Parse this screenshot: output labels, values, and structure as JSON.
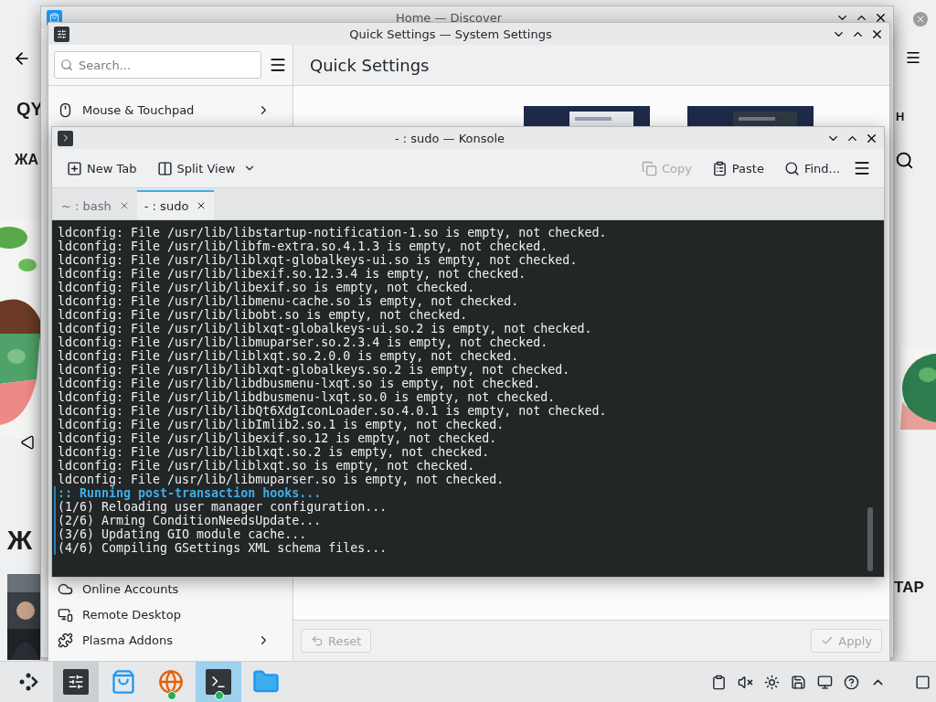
{
  "behind_window": {
    "heading_1": "QY",
    "heading_2": "ЖА",
    "heading_3": "Ж",
    "label_right_1": "Н",
    "label_right_2": "ТАР"
  },
  "discover": {
    "title": "Home — Discover"
  },
  "settings": {
    "title": "Quick Settings — System Settings",
    "search_placeholder": "Search...",
    "heading": "Quick Settings",
    "sidebar": [
      {
        "label": "Mouse & Touchpad",
        "kind": "mouse",
        "expandable": true
      },
      {
        "label": "Online Accounts",
        "kind": "cloud",
        "expandable": false
      },
      {
        "label": "Remote Desktop",
        "kind": "remote",
        "expandable": false
      },
      {
        "label": "Plasma Addons",
        "kind": "addons",
        "expandable": true
      }
    ],
    "buttons": [
      {
        "label": "Reset",
        "kind": "reset",
        "disabled": true
      },
      {
        "label": "Apply",
        "kind": "apply",
        "disabled": true
      }
    ]
  },
  "konsole": {
    "title": "- : sudo — Konsole",
    "toolbar": [
      {
        "label": "New Tab",
        "kind": "new-tab",
        "disabled": false
      },
      {
        "label": "Split View",
        "kind": "split",
        "disabled": false
      },
      {
        "label": "Copy",
        "kind": "copy",
        "disabled": true
      },
      {
        "label": "Paste",
        "kind": "paste",
        "disabled": false
      },
      {
        "label": "Find...",
        "kind": "find",
        "disabled": false
      }
    ],
    "tabs": [
      {
        "label": "~ : bash",
        "selected": false
      },
      {
        "label": "- : sudo",
        "selected": true
      }
    ],
    "lines": [
      {
        "text": "ldconfig: File /usr/lib/libstartup-notification-1.so is empty, not checked.",
        "kind": "plain"
      },
      {
        "text": "ldconfig: File /usr/lib/libfm-extra.so.4.1.3 is empty, not checked.",
        "kind": "plain"
      },
      {
        "text": "ldconfig: File /usr/lib/liblxqt-globalkeys-ui.so is empty, not checked.",
        "kind": "plain"
      },
      {
        "text": "ldconfig: File /usr/lib/libexif.so.12.3.4 is empty, not checked.",
        "kind": "plain"
      },
      {
        "text": "ldconfig: File /usr/lib/libexif.so is empty, not checked.",
        "kind": "plain"
      },
      {
        "text": "ldconfig: File /usr/lib/libmenu-cache.so is empty, not checked.",
        "kind": "plain"
      },
      {
        "text": "ldconfig: File /usr/lib/libobt.so is empty, not checked.",
        "kind": "plain"
      },
      {
        "text": "ldconfig: File /usr/lib/liblxqt-globalkeys-ui.so.2 is empty, not checked.",
        "kind": "plain"
      },
      {
        "text": "ldconfig: File /usr/lib/libmuparser.so.2.3.4 is empty, not checked.",
        "kind": "plain"
      },
      {
        "text": "ldconfig: File /usr/lib/liblxqt.so.2.0.0 is empty, not checked.",
        "kind": "plain"
      },
      {
        "text": "ldconfig: File /usr/lib/liblxqt-globalkeys.so.2 is empty, not checked.",
        "kind": "plain"
      },
      {
        "text": "ldconfig: File /usr/lib/libdbusmenu-lxqt.so is empty, not checked.",
        "kind": "plain"
      },
      {
        "text": "ldconfig: File /usr/lib/libdbusmenu-lxqt.so.0 is empty, not checked.",
        "kind": "plain"
      },
      {
        "text": "ldconfig: File /usr/lib/libQt6XdgIconLoader.so.4.0.1 is empty, not checked.",
        "kind": "plain"
      },
      {
        "text": "ldconfig: File /usr/lib/libImlib2.so.1 is empty, not checked.",
        "kind": "plain"
      },
      {
        "text": "ldconfig: File /usr/lib/libexif.so.12 is empty, not checked.",
        "kind": "plain"
      },
      {
        "text": "ldconfig: File /usr/lib/liblxqt.so.2 is empty, not checked.",
        "kind": "plain"
      },
      {
        "text": "ldconfig: File /usr/lib/liblxqt.so is empty, not checked.",
        "kind": "plain"
      },
      {
        "text": "ldconfig: File /usr/lib/libmuparser.so is empty, not checked.",
        "kind": "plain"
      },
      {
        "text": ":: Running post-transaction hooks...",
        "kind": "heading"
      },
      {
        "text": "(1/6) Reloading user manager configuration...",
        "kind": "step"
      },
      {
        "text": "(2/6) Arming ConditionNeedsUpdate...",
        "kind": "step"
      },
      {
        "text": "(3/6) Updating GIO module cache...",
        "kind": "step"
      },
      {
        "text": "(4/6) Compiling GSettings XML schema files...",
        "kind": "step"
      }
    ]
  },
  "taskbar": {
    "items": [
      {
        "kind": "launcher",
        "open": false,
        "active": false,
        "badge": false
      },
      {
        "kind": "settings",
        "open": true,
        "active": false,
        "badge": false
      },
      {
        "kind": "store",
        "open": false,
        "active": false,
        "badge": false
      },
      {
        "kind": "browser",
        "open": false,
        "active": false,
        "badge": true
      },
      {
        "kind": "terminal",
        "open": true,
        "active": true,
        "badge": true
      },
      {
        "kind": "files",
        "open": false,
        "active": false,
        "badge": false
      }
    ],
    "tray": [
      {
        "kind": "clipboard"
      },
      {
        "kind": "muted"
      },
      {
        "kind": "brightness"
      },
      {
        "kind": "disk"
      },
      {
        "kind": "display"
      },
      {
        "kind": "help"
      },
      {
        "kind": "expand"
      },
      {
        "kind": "desktop"
      }
    ]
  }
}
